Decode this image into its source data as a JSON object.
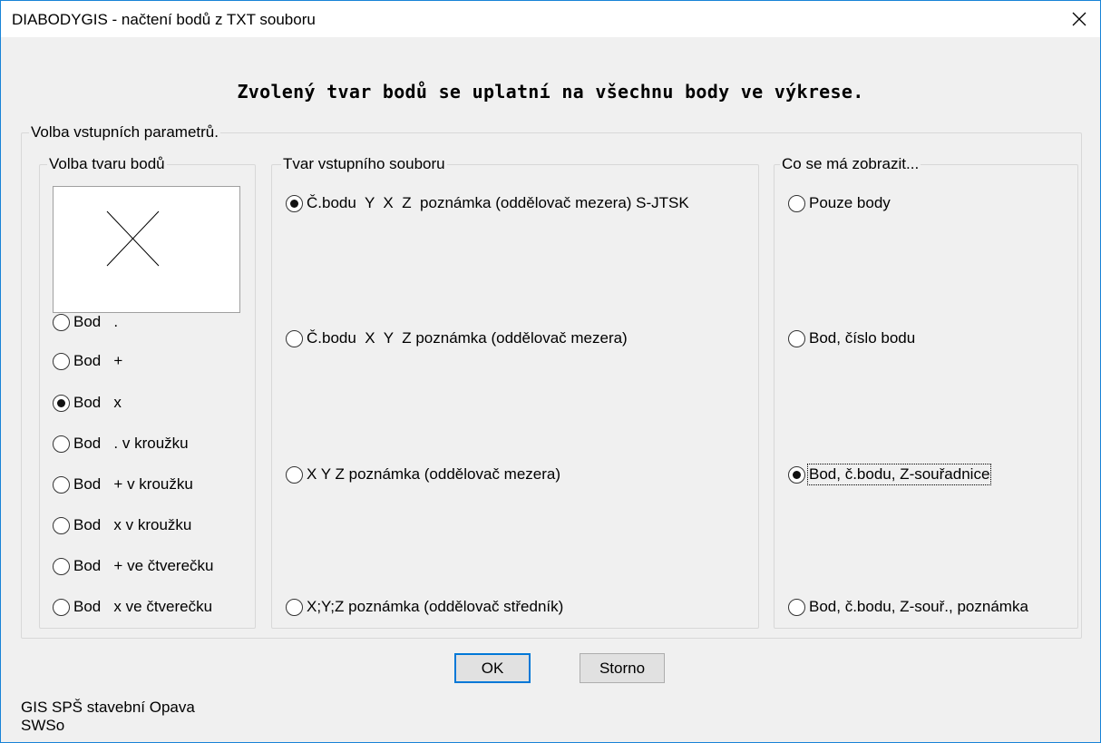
{
  "window": {
    "title": "DIABODYGIS - načtení bodů z TXT souboru",
    "close_icon": "close-icon",
    "accent": "#0078d7"
  },
  "heading": "Zvolený tvar bodů se uplatní na všechnu body ve výkrese.",
  "params_group": {
    "label": "Volba vstupních parametrů."
  },
  "shape_group": {
    "label": "Volba tvaru bodů",
    "preview_icon": "x-cross-icon",
    "options": [
      {
        "label": "Bod   .",
        "checked": false
      },
      {
        "label": "Bod   +",
        "checked": false
      },
      {
        "label": "Bod   x",
        "checked": true
      },
      {
        "label": "Bod   . v kroužku",
        "checked": false
      },
      {
        "label": "Bod   + v kroužku",
        "checked": false
      },
      {
        "label": "Bod   x v kroužku",
        "checked": false
      },
      {
        "label": "Bod   + ve čtverečku",
        "checked": false
      },
      {
        "label": "Bod   x ve čtverečku",
        "checked": false
      }
    ]
  },
  "format_group": {
    "label": "Tvar vstupního souboru",
    "options": [
      {
        "label": "Č.bodu  Y  X  Z  poznámka (oddělovač mezera) S-JTSK",
        "checked": true
      },
      {
        "label": "Č.bodu  X  Y  Z poznámka (oddělovač mezera)",
        "checked": false
      },
      {
        "label": "X Y Z poznámka (oddělovač mezera)",
        "checked": false
      },
      {
        "label": "X;Y;Z poznámka (oddělovač středník)",
        "checked": false
      }
    ]
  },
  "display_group": {
    "label": "Co se má zobrazit...",
    "options": [
      {
        "label": "Pouze body",
        "checked": false
      },
      {
        "label": "Bod, číslo bodu",
        "checked": false
      },
      {
        "label": "Bod, č.bodu, Z-souřadnice",
        "checked": true
      },
      {
        "label": "Bod, č.bodu, Z-souř., poznámka",
        "checked": false
      }
    ]
  },
  "buttons": {
    "ok": "OK",
    "cancel": "Storno"
  },
  "footer": {
    "line1": "GIS SPŠ stavební Opava",
    "line2": "SWSo"
  }
}
